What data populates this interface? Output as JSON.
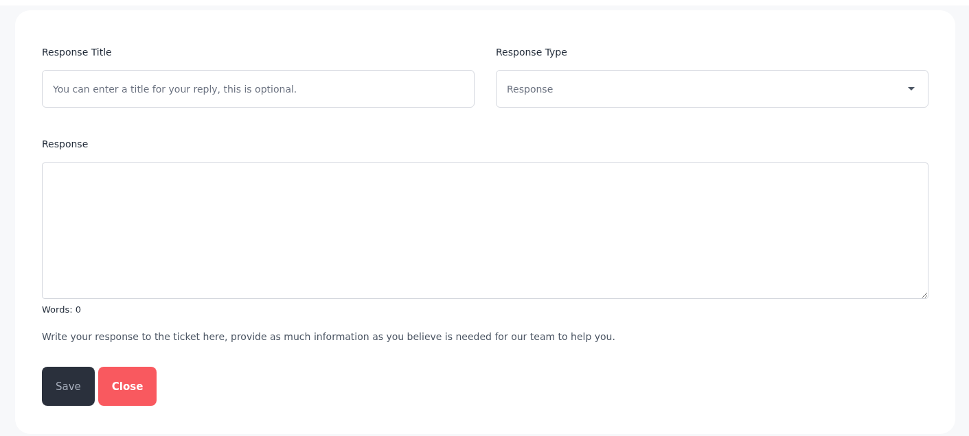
{
  "form": {
    "title_field": {
      "label": "Response Title",
      "placeholder": "You can enter a title for your reply, this is optional."
    },
    "type_field": {
      "label": "Response Type",
      "value": "Response"
    },
    "response_field": {
      "label": "Response",
      "word_count": "Words: 0",
      "help": "Write your response to the ticket here, provide as much information as you believe is needed for our team to help you."
    },
    "buttons": [
      {
        "label": "Save",
        "kind": "primary"
      },
      {
        "label": "Close",
        "kind": "danger"
      }
    ]
  }
}
